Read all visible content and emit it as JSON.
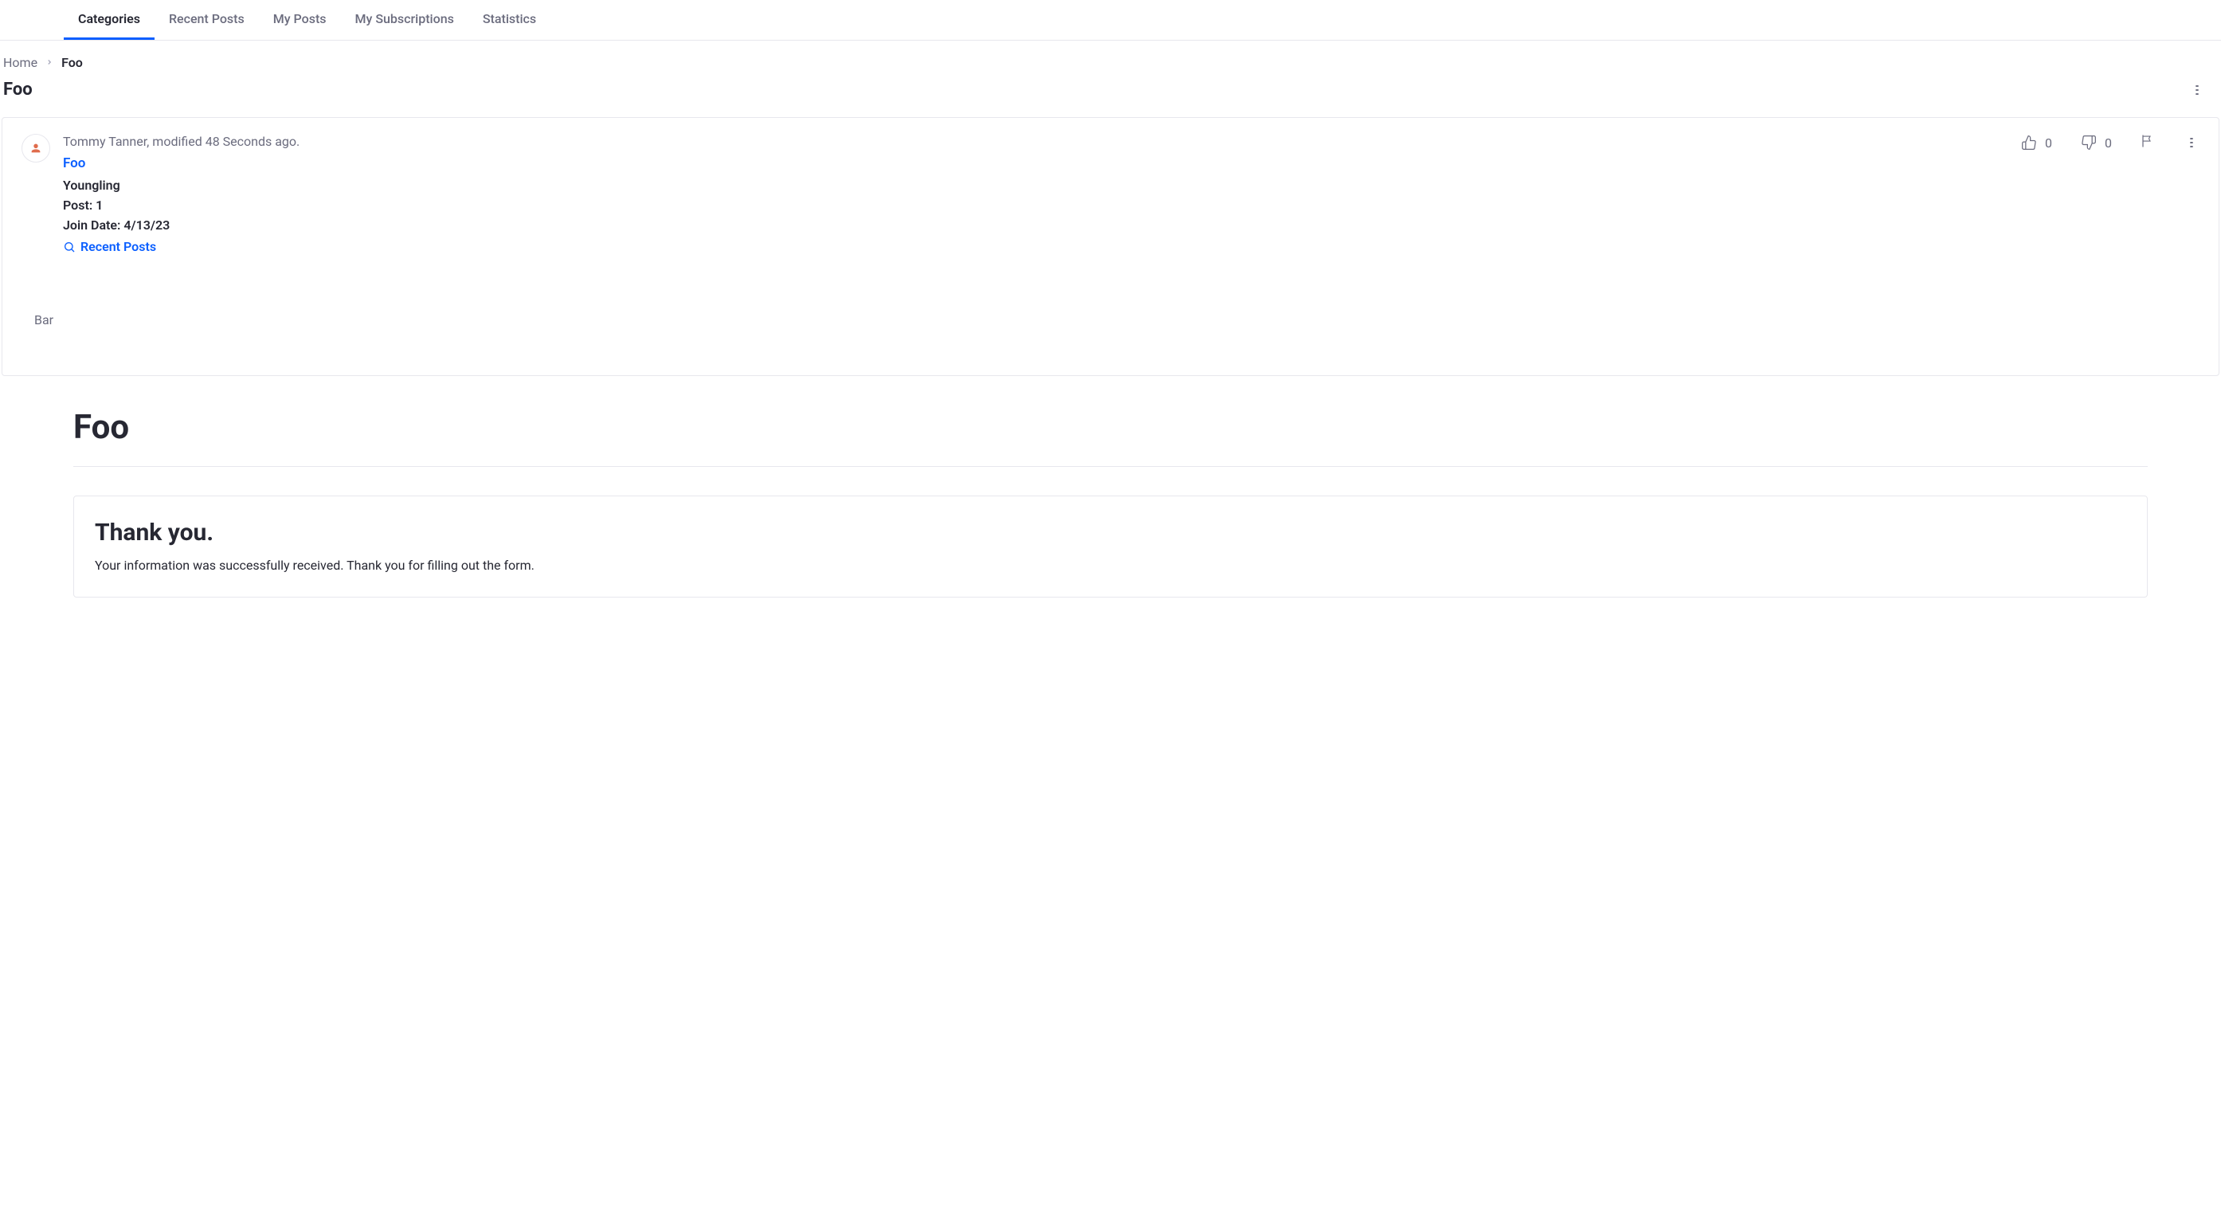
{
  "tabs": {
    "categories": "Categories",
    "recent_posts": "Recent Posts",
    "my_posts": "My Posts",
    "my_subscriptions": "My Subscriptions",
    "statistics": "Statistics"
  },
  "breadcrumb": {
    "home": "Home",
    "current": "Foo"
  },
  "page_title": "Foo",
  "post": {
    "byline": "Tommy Tanner, modified 48 Seconds ago.",
    "title": "Foo",
    "rank": "Youngling",
    "post_count_label": "Post: 1",
    "join_date_label": "Join Date: 4/13/23",
    "recent_posts_label": "Recent Posts",
    "upvotes": "0",
    "downvotes": "0",
    "content": "Bar"
  },
  "form": {
    "heading": "Foo",
    "thank_you_title": "Thank you.",
    "thank_you_text": "Your information was successfully received. Thank you for filling out the form."
  }
}
